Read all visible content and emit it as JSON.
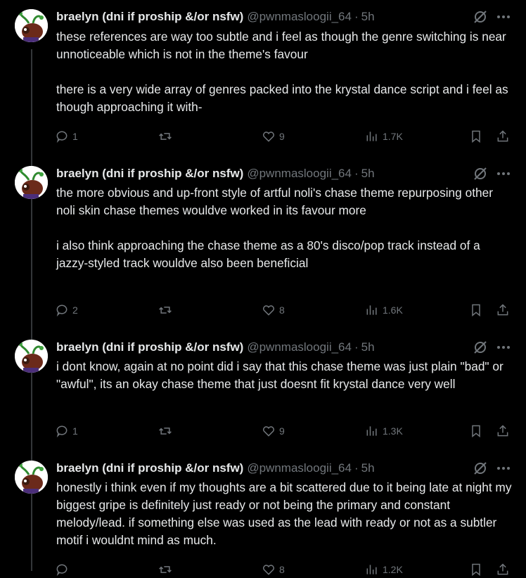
{
  "tweets": [
    {
      "author_name": "braelyn (dni if proship &/or nsfw)",
      "handle": "@pwnmasloogii_64",
      "separator": "·",
      "time": "5h",
      "paragraphs": [
        "these references are way too subtle and i feel as though the genre switching is near unnoticeable which is not in the theme's favour",
        "there is a very wide array of genres packed into the krystal dance script and i feel as though approaching it with-"
      ],
      "replies": "1",
      "retweets": "",
      "likes": "9",
      "views": "1.7K"
    },
    {
      "author_name": "braelyn (dni if proship &/or nsfw)",
      "handle": "@pwnmasloogii_64",
      "separator": "·",
      "time": "5h",
      "paragraphs": [
        "the more obvious and up-front style of artful noli's chase theme repurposing other noli skin chase themes wouldve worked in its favour more",
        "i also think approaching the chase theme as a 80's disco/pop track instead of a jazzy-styled track wouldve also been beneficial"
      ],
      "replies": "2",
      "retweets": "",
      "likes": "8",
      "views": "1.6K"
    },
    {
      "author_name": "braelyn (dni if proship &/or nsfw)",
      "handle": "@pwnmasloogii_64",
      "separator": "·",
      "time": "5h",
      "paragraphs": [
        "i dont know, again at no point did i say that this chase theme was just plain \"bad\" or \"awful\", its an okay chase theme that just doesnt fit krystal dance very well"
      ],
      "replies": "1",
      "retweets": "",
      "likes": "9",
      "views": "1.3K"
    },
    {
      "author_name": "braelyn (dni if proship &/or nsfw)",
      "handle": "@pwnmasloogii_64",
      "separator": "·",
      "time": "5h",
      "paragraphs": [
        "honestly i think even if my thoughts are a bit scattered due to it being late at night my biggest gripe is definitely just ready or not being the primary and constant melody/lead. if something else was used as the lead with ready or not as a subtler motif i wouldnt mind as much."
      ],
      "replies": "",
      "retweets": "",
      "likes": "8",
      "views": "1.2K"
    }
  ],
  "icons": {
    "reply": "reply-icon",
    "retweet": "retweet-icon",
    "like": "heart-icon",
    "views": "views-icon",
    "bookmark": "bookmark-icon",
    "share": "share-icon",
    "grok": "grok-icon",
    "more": "more-icon"
  },
  "colors": {
    "background": "#000000",
    "text": "#e7e9ea",
    "muted": "#71767b",
    "thread_line": "#333639"
  }
}
